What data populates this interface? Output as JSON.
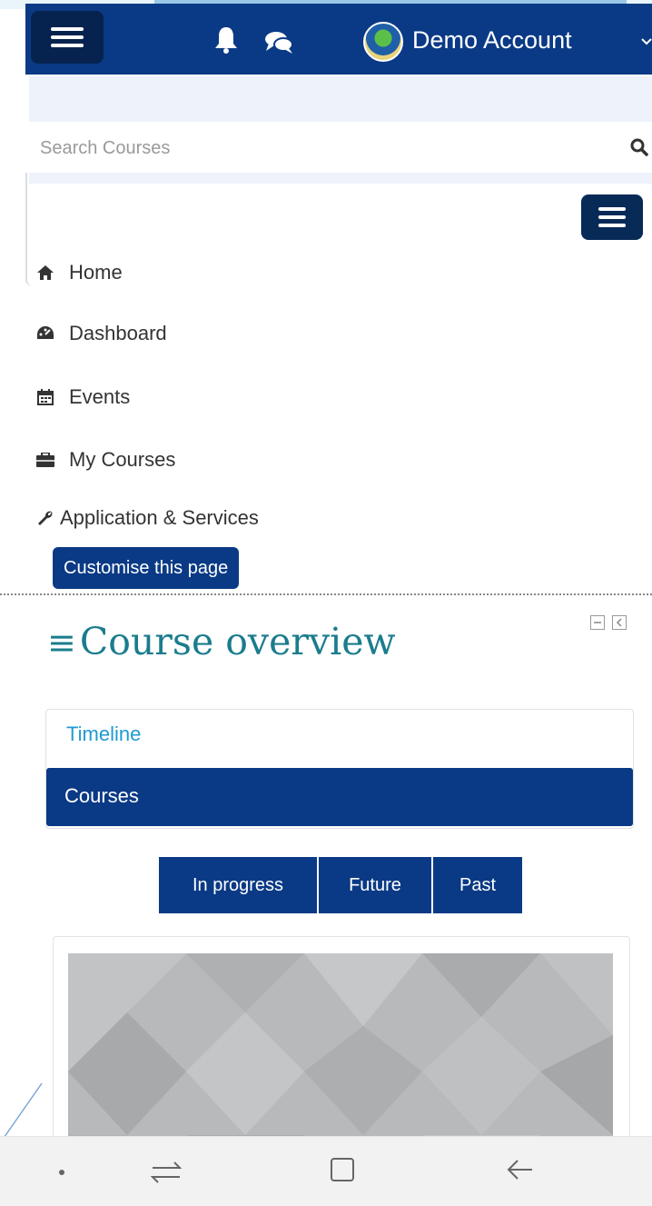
{
  "header": {
    "account_name": "Demo Account",
    "nav_toggle_icon": "hamburger-icon",
    "notifications_icon": "bell-icon",
    "messages_icon": "chat-icon",
    "avatar_icon": "avatar-icon",
    "brand_color": "#0a3a85"
  },
  "search": {
    "placeholder": "Search Courses",
    "value": "",
    "icon": "search-icon"
  },
  "menu": {
    "items": [
      {
        "label": "Home",
        "icon": "home-icon"
      },
      {
        "label": "Dashboard",
        "icon": "dashboard-icon"
      },
      {
        "label": "Events",
        "icon": "calendar-icon"
      },
      {
        "label": "My Courses",
        "icon": "briefcase-icon"
      },
      {
        "label": "Application & Services",
        "icon": "wrench-icon"
      }
    ],
    "customise_label": "Customise this page"
  },
  "course_overview": {
    "title": "Course overview",
    "tabs": [
      {
        "label": "Timeline",
        "active": false
      },
      {
        "label": "Courses",
        "active": true
      }
    ],
    "filters": [
      {
        "label": "In progress"
      },
      {
        "label": "Future"
      },
      {
        "label": "Past"
      }
    ],
    "accent_color": "#1a7c8d"
  },
  "system_nav": {
    "recents_icon": "recents-icon",
    "home_icon": "home-square-icon",
    "back_icon": "back-arrow-icon"
  }
}
